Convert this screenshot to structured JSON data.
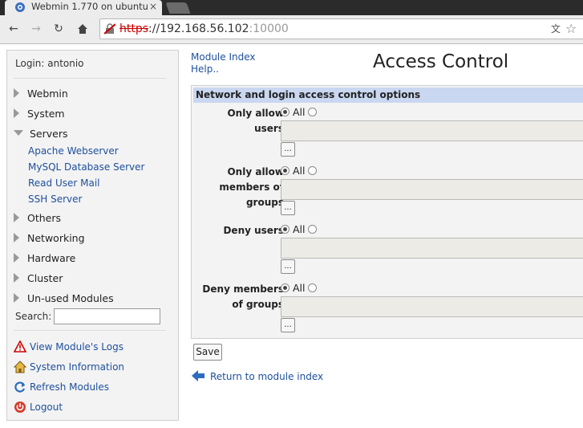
{
  "browser": {
    "tab_title": "Webmin 1.770 on ubuntu",
    "url_scheme": "https",
    "url_host": "://192.168.56.102",
    "url_port": ":10000"
  },
  "sidebar": {
    "login": "Login: antonio",
    "categories": [
      {
        "label": "Webmin",
        "expanded": false
      },
      {
        "label": "System",
        "expanded": false
      },
      {
        "label": "Servers",
        "expanded": true
      },
      {
        "label": "Others",
        "expanded": false
      },
      {
        "label": "Networking",
        "expanded": false
      },
      {
        "label": "Hardware",
        "expanded": false
      },
      {
        "label": "Cluster",
        "expanded": false
      },
      {
        "label": "Un-used Modules",
        "expanded": false
      }
    ],
    "server_modules": [
      "Apache Webserver",
      "MySQL Database Server",
      "Read User Mail",
      "SSH Server"
    ],
    "search_label": "Search:",
    "search_value": "",
    "links": [
      {
        "label": "View Module's Logs",
        "icon": "warning-icon"
      },
      {
        "label": "System Information",
        "icon": "home-icon"
      },
      {
        "label": "Refresh Modules",
        "icon": "refresh-icon"
      },
      {
        "label": "Logout",
        "icon": "power-icon"
      }
    ]
  },
  "main": {
    "module_index": "Module Index",
    "help": "Help..",
    "title": "Access Control",
    "section_header": "Network and login access control options",
    "fields": [
      {
        "label_1": "Only allow",
        "label_2": "users",
        "label_3": "",
        "option": "All"
      },
      {
        "label_1": "Only allow",
        "label_2": "members of",
        "label_3": "groups",
        "option": "All"
      },
      {
        "label_1": "Deny users",
        "label_2": "",
        "label_3": "",
        "option": "All"
      },
      {
        "label_1": "Deny members",
        "label_2": "of groups",
        "label_3": "",
        "option": "All"
      }
    ],
    "browse_button": "...",
    "save_button": "Save",
    "return_link": "Return to module index"
  },
  "colors": {
    "link": "#1e4f9c",
    "section_header_bg": "#c9d7f1",
    "panel_bg": "#f3f3f3"
  }
}
